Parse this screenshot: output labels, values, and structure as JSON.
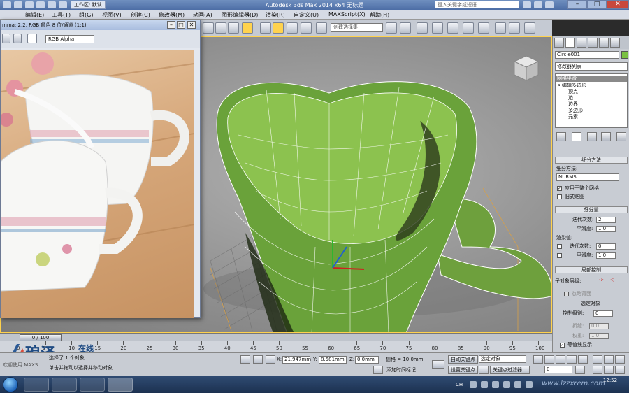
{
  "window": {
    "title": "Autodesk 3ds Max  2014 x64     无标题",
    "workspace_label": "工作区: 默认",
    "search_placeholder": "键入关键字或短语"
  },
  "menus": [
    "编辑(E)",
    "工具(T)",
    "组(G)",
    "视图(V)",
    "创建(C)",
    "修改器(M)",
    "动画(A)",
    "图形编辑器(D)",
    "渲染(R)",
    "自定义(U)",
    "MAXScript(X)",
    "帮助(H)"
  ],
  "toolbar": {
    "selection_set_placeholder": "创建选择集"
  },
  "frame_buffer": {
    "title": "mma: 2.2, RGB 颜色 8 位/通道 (1:1)",
    "channel": "RGB Alpha"
  },
  "command_panel": {
    "object_name": "Circle001",
    "object_color": "#7ac143",
    "modifier_list": "修改器列表",
    "stack": [
      {
        "label": "网格平滑",
        "selected": true,
        "level": 0
      },
      {
        "label": "可编辑多边形",
        "selected": false,
        "level": 0
      },
      {
        "label": "顶点",
        "selected": false,
        "level": 1
      },
      {
        "label": "边",
        "selected": false,
        "level": 1
      },
      {
        "label": "边界",
        "selected": false,
        "level": 1
      },
      {
        "label": "多边形",
        "selected": false,
        "level": 1
      },
      {
        "label": "元素",
        "selected": false,
        "level": 1
      }
    ],
    "subdivision_method": {
      "header": "细分方法",
      "method_label": "细分方法:",
      "method_value": "NURMS",
      "apply_whole_mesh": "应用于整个网格",
      "old_style_mapping": "旧式贴图"
    },
    "subdivision_amount": {
      "header": "细分量",
      "iterations_label": "迭代次数:",
      "iterations_value": "2",
      "smoothness_label": "平滑度:",
      "smoothness_value": "1.0",
      "render_values": "渲染值:",
      "render_iterations_label": "迭代次数:",
      "render_iterations_value": "0",
      "render_smoothness_label": "平滑度:",
      "render_smoothness_value": "1.0"
    },
    "local_control": {
      "header": "局部控制",
      "sub_object_level": "子对象层级:",
      "ignore_backfacing": "忽略背面",
      "control_level_header": "选定对象",
      "control_level_label": "控制级别:",
      "control_level_value": "0",
      "crease_label": "折缝:",
      "crease_value": "0.0",
      "weight_label": "权重:",
      "weight_value": "1.0",
      "isoline_display": "等值线显示"
    }
  },
  "timeline": {
    "slider": "0 / 100",
    "ticks": [
      0,
      5,
      10,
      15,
      20,
      25,
      30,
      35,
      40,
      45,
      50,
      55,
      60,
      65,
      70,
      75,
      80,
      85,
      90,
      95,
      100
    ]
  },
  "status": {
    "selected": "选择了 1 个对象",
    "prompt": "单击并拖动以选择并移动对象",
    "welcome": "欢迎使用 MAXS",
    "x_label": "X:",
    "x_value": "21.947mm",
    "y_label": "Y:",
    "y_value": "8.581mm",
    "z_label": "Z:",
    "z_value": "0.0mm",
    "grid": "栅格 = 10.0mm",
    "add_time_tag": "添加时间标记",
    "auto_key": "自动关键点",
    "selected_object": "选定对象",
    "set_key": "设置关键点",
    "key_filters": "关键点过滤器...",
    "frame": "0"
  },
  "logo": {
    "name": "琅泽",
    "suffix": "在线"
  },
  "taskbar": {
    "time": "12:52",
    "lang": "CH",
    "watermark": "www.lzzxrem.com"
  }
}
